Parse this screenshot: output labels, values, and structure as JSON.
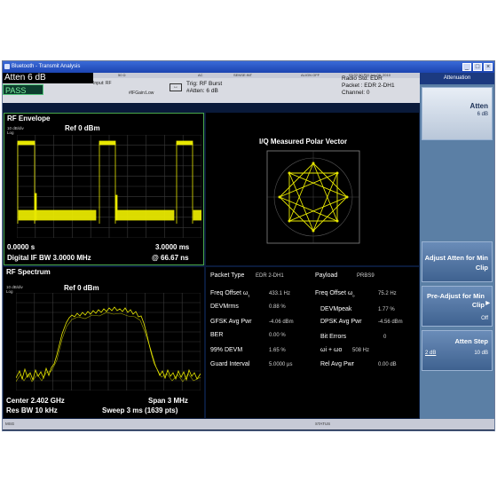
{
  "window": {
    "title": "Bluetooth - Transmit Analysis",
    "buttons": [
      "_",
      "□",
      "×"
    ]
  },
  "topstrip": {
    "f1": "50 Ω",
    "f2": "AC",
    "f3": "SENSE:INT",
    "f4": "ALIGN OFF",
    "f5": "03:32:30 PM Jun 08, 2010"
  },
  "info": {
    "atten": "Atten  6 dB",
    "pass": "PASS",
    "input": "Input: RF",
    "gain": "#IFGain:Low",
    "trig": "Trig: RF Burst",
    "atten2": "#Atten: 6 dB",
    "radio_std": "Radio Std: EDR",
    "packet": "Packet : EDR 2-DH1",
    "channel": "Channel: 0"
  },
  "rf_envelope": {
    "title": "RF Envelope",
    "ref": "Ref  0 dBm",
    "scale": "10 dB/div",
    "log": "Log",
    "start": "0.0000 s",
    "stop": "3.0000 ms",
    "bw": "Digital IF BW 3.0000 MHz",
    "at": "@ 66.67 ns"
  },
  "polar": {
    "title": "I/Q Measured Polar Vector"
  },
  "rf_spectrum": {
    "title": "RF Spectrum",
    "ref": "Ref  0 dBm",
    "scale": "10 dB/div",
    "log": "Log",
    "center": "Center  2.402 GHz",
    "span": "Span 3 MHz",
    "res_bw": "Res BW  10 kHz",
    "sweep": "Sweep  3 ms (1639 pts)"
  },
  "metrics": {
    "packet_type_label": "Packet Type",
    "packet_type": "EDR 2-DH1",
    "payload_label": "Payload",
    "payload": "PRBS9",
    "freq_offset_w1_label": "Freq Offset ω",
    "freq_offset_w1_sub": "1",
    "freq_offset_w1": "433.1 Hz",
    "freq_offset_w0_label": "Freq Offset ω",
    "freq_offset_w0_sub": "o",
    "freq_offset_w0": "75.2 Hz",
    "devm_rms_label": "DEVMrms",
    "devm_rms": "0.88 %",
    "devm_peak_label": "DEVMpeak",
    "devm_peak": "1.77 %",
    "gfsk_label": "GFSK Avg Pwr",
    "gfsk": "-4.06 dBm",
    "dpsk_label": "DPSK Avg Pwr",
    "dpsk": "-4.56 dBm",
    "ber_label": "BER",
    "ber": "0.00 %",
    "bit_errors_label": "Bit Errors",
    "bit_errors": "0",
    "devm99_label": "99% DEVM",
    "devm99": "1.65 %",
    "wi_w0_label": "ωi + ωo",
    "wi_w0": "508 Hz",
    "guard_label": "Guard Interval",
    "guard": "5.0000 µs",
    "rel_avg_label": "Rel Avg Pwr",
    "rel_avg": "0.00 dB"
  },
  "softkeys": {
    "title": "Attenuation",
    "atten_label": "Atten",
    "atten_value": "6 dB",
    "adjust_label": "Adjust Atten for Min Clip",
    "preadjust_label": "Pre-Adjust for Min Clip",
    "preadjust_value": "Off",
    "step_label": "Atten Step",
    "step_opt1": "2 dB",
    "step_opt2": "10 dB"
  },
  "statusbar": {
    "left": "MSG",
    "center": "STATUS"
  },
  "colors": {
    "trace": "#e8e800",
    "panel_border_active": "#4aa84a",
    "screen_bg": "#0a1a3a"
  }
}
